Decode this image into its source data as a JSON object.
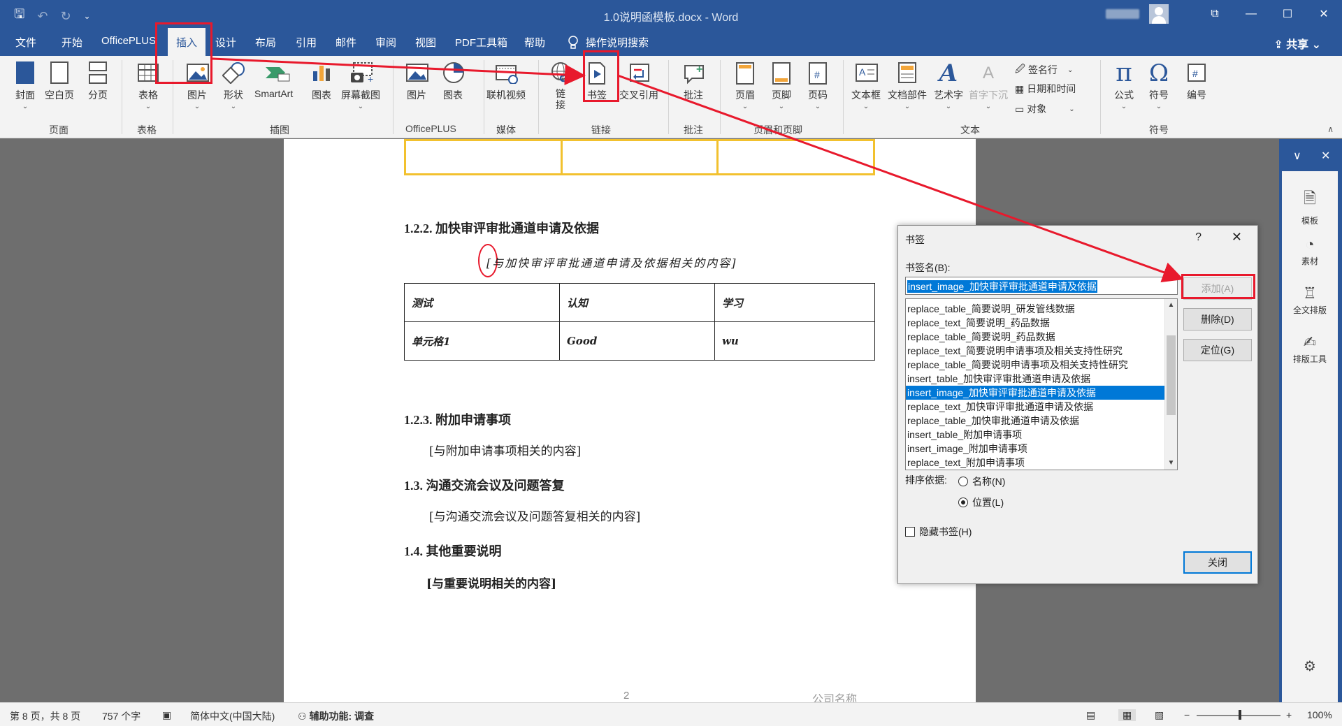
{
  "window": {
    "title": "1.0说明函模板.docx - Word"
  },
  "quick_access": {
    "save": "🖫",
    "undo": "↶",
    "redo": "↻",
    "customize": "⌄"
  },
  "window_controls": {
    "restore_ribbon": "⧉",
    "minimize": "—",
    "maximize": "☐",
    "close": "✕"
  },
  "tabs": [
    "文件",
    "开始",
    "OfficePLUS",
    "插入",
    "设计",
    "布局",
    "引用",
    "邮件",
    "审阅",
    "视图",
    "PDF工具箱",
    "帮助"
  ],
  "active_tab": "插入",
  "tell_me": "操作说明搜索",
  "share": "共享",
  "ribbon": {
    "cover": "封面",
    "blank_page": "空白页",
    "page_break": "分页",
    "table": "表格",
    "picture": "图片",
    "shapes": "形状",
    "smartart": "SmartArt",
    "chart": "图表",
    "screenshot": "屏幕截图",
    "op_picture": "图片",
    "op_chart": "图表",
    "online_video": "联机视频",
    "link": "链接",
    "bookmark": "书签",
    "cross_ref": "交叉引用",
    "comment": "批注",
    "header": "页眉",
    "footer": "页脚",
    "page_number": "页码",
    "textbox": "文本框",
    "quick_parts": "文档部件",
    "wordart": "艺术字",
    "dropcap": "首字下沉",
    "signature": "签名行",
    "datetime": "日期和时间",
    "object": "对象",
    "equation": "公式",
    "symbol": "符号",
    "number": "编号",
    "groups": {
      "pages": "页面",
      "tables": "表格",
      "illustrations": "插图",
      "officeplus": "OfficePLUS",
      "media": "媒体",
      "links": "链接",
      "comments": "批注",
      "header_footer": "页眉和页脚",
      "text": "文本",
      "symbols": "符号"
    },
    "glyphs": {
      "pi": "π",
      "omega": "Ω",
      "hash": "#",
      "wordart_a": "A",
      "dropcap_a": "A"
    }
  },
  "document": {
    "h122": "1.2.2. 加快审评审批通道申请及依据",
    "p122": "与加快审评审批通道申请及依据相关的内容",
    "table": [
      [
        "测试",
        "认知",
        "学习"
      ],
      [
        "单元格1",
        "Good",
        "wu"
      ]
    ],
    "h123": "1.2.3. 附加申请事项",
    "p123": "与附加申请事项相关的内容",
    "h13": "1.3. 沟通交流会议及问题答复",
    "p13": "与沟通交流会议及问题答复相关的内容",
    "h14": "1.4. 其他重要说明",
    "p14": "与重要说明相关的内容",
    "page_num": "2",
    "company": "公司名称"
  },
  "dialog": {
    "title": "书签",
    "help": "?",
    "close_x": "✕",
    "name_label": "书签名(B):",
    "name_value": "insert_image_加快审评审批通道申请及依据",
    "items": [
      "replace_table_简要说明_研发管线数据",
      "replace_text_简要说明_药品数据",
      "replace_table_简要说明_药品数据",
      "replace_text_简要说明申请事项及相关支持性研究",
      "replace_table_简要说明申请事项及相关支持性研究",
      "insert_table_加快审评审批通道申请及依据",
      "insert_image_加快审评审批通道申请及依据",
      "replace_text_加快审评审批通道申请及依据",
      "replace_table_加快审批通道申请及依据",
      "insert_table_附加申请事项",
      "insert_image_附加申请事项",
      "replace_text_附加申请事项"
    ],
    "selected_index": 6,
    "add": "添加(A)",
    "delete": "删除(D)",
    "goto": "定位(G)",
    "sort_label": "排序依据:",
    "sort_name": "名称(N)",
    "sort_position": "位置(L)",
    "sort_selected": "position",
    "hidden": "隐藏书签(H)",
    "close": "关闭"
  },
  "side_pane": {
    "items": [
      {
        "label": "模板",
        "icon": "template-icon",
        "glyph": "🗎"
      },
      {
        "label": "素材",
        "icon": "material-icon",
        "glyph": "◔"
      },
      {
        "label": "全文排版",
        "icon": "layout-icon",
        "glyph": "♖"
      },
      {
        "label": "排版工具",
        "icon": "tool-icon",
        "glyph": "✍"
      }
    ],
    "settings": "⚙",
    "collapse": "∨",
    "close": "✕"
  },
  "status": {
    "page": "第 8 页，共 8 页",
    "words": "757 个字",
    "language": "简体中文(中国大陆)",
    "accessibility": "辅助功能: 调查",
    "zoom_minus": "−",
    "zoom_plus": "+",
    "zoom": "100%",
    "zoom_level": 1.0
  },
  "colors": {
    "word_blue": "#2b579a",
    "annotation_red": "#e8192c",
    "selection_blue": "#0078d7",
    "table_yellow": "#f2c12e"
  }
}
